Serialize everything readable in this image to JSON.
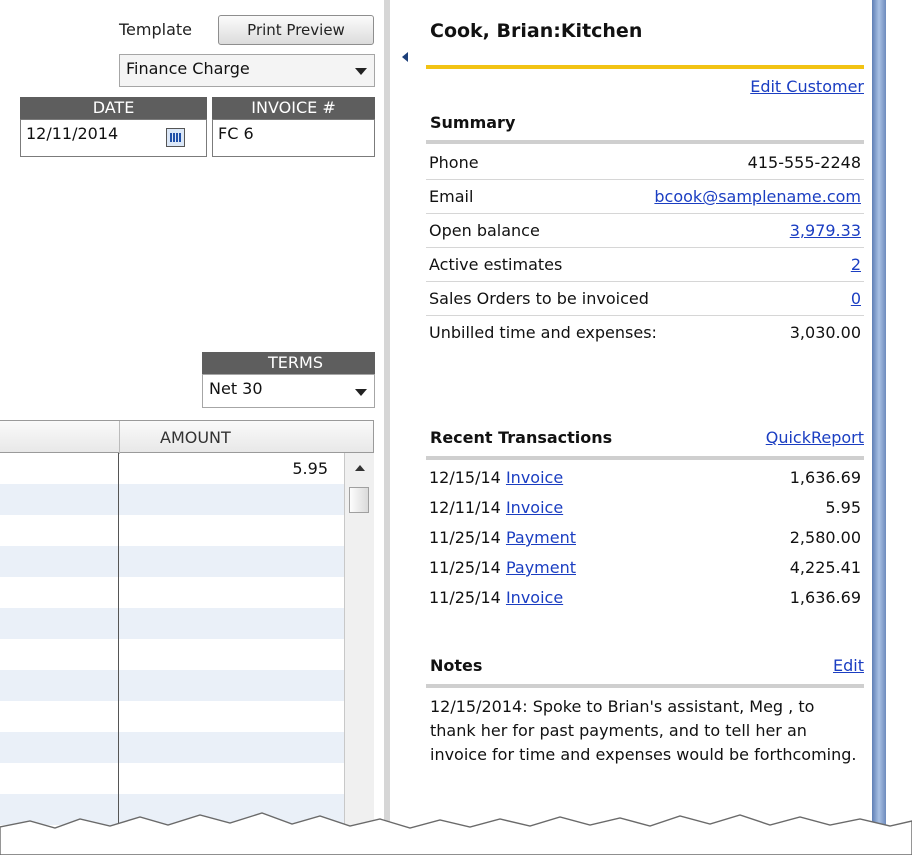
{
  "invoice": {
    "template_label": "Template",
    "print_preview_label": "Print Preview",
    "template_value": "Finance Charge",
    "date_header": "DATE",
    "date_value": "12/11/2014",
    "invoice_no_header": "INVOICE #",
    "invoice_no_value": "FC 6",
    "terms_header": "TERMS",
    "terms_value": "Net 30",
    "amount_header": "AMOUNT",
    "rows": [
      {
        "amount": "5.95"
      },
      {
        "amount": ""
      },
      {
        "amount": ""
      },
      {
        "amount": ""
      },
      {
        "amount": ""
      },
      {
        "amount": ""
      },
      {
        "amount": ""
      },
      {
        "amount": ""
      },
      {
        "amount": ""
      },
      {
        "amount": ""
      },
      {
        "amount": ""
      },
      {
        "amount": ""
      }
    ]
  },
  "customer": {
    "name": "Cook, Brian:Kitchen",
    "edit_customer": "Edit Customer",
    "summary_title": "Summary",
    "summary": [
      {
        "label": "Phone",
        "value": "415-555-2248",
        "link": false
      },
      {
        "label": "Email",
        "value": "bcook@samplename.com",
        "link": true
      },
      {
        "label": "Open balance",
        "value": "3,979.33",
        "link": true
      },
      {
        "label": "Active estimates",
        "value": "2",
        "link": true
      },
      {
        "label": "Sales Orders to be invoiced",
        "value": "0",
        "link": true
      },
      {
        "label": "Unbilled time and expenses:",
        "value": "3,030.00",
        "link": false
      }
    ],
    "recent_title": "Recent Transactions",
    "quick_report": "QuickReport",
    "transactions": [
      {
        "date": "12/15/14",
        "type": "Invoice",
        "amount": "1,636.69"
      },
      {
        "date": "12/11/14",
        "type": "Invoice",
        "amount": "5.95"
      },
      {
        "date": "11/25/14",
        "type": "Payment",
        "amount": "2,580.00"
      },
      {
        "date": "11/25/14",
        "type": "Payment",
        "amount": "4,225.41"
      },
      {
        "date": "11/25/14",
        "type": "Invoice",
        "amount": "1,636.69"
      }
    ],
    "notes_title": "Notes",
    "notes_edit": "Edit",
    "notes_text": "12/15/2014:  Spoke to Brian's assistant, Meg , to thank her for past payments, and to tell her an invoice for time and expenses would be forthcoming."
  },
  "colors": {
    "accent_gold": "#f2c314",
    "link_blue": "#1b3ec2",
    "header_gray": "#5e5e5e",
    "row_alt": "#eaf0f8"
  }
}
